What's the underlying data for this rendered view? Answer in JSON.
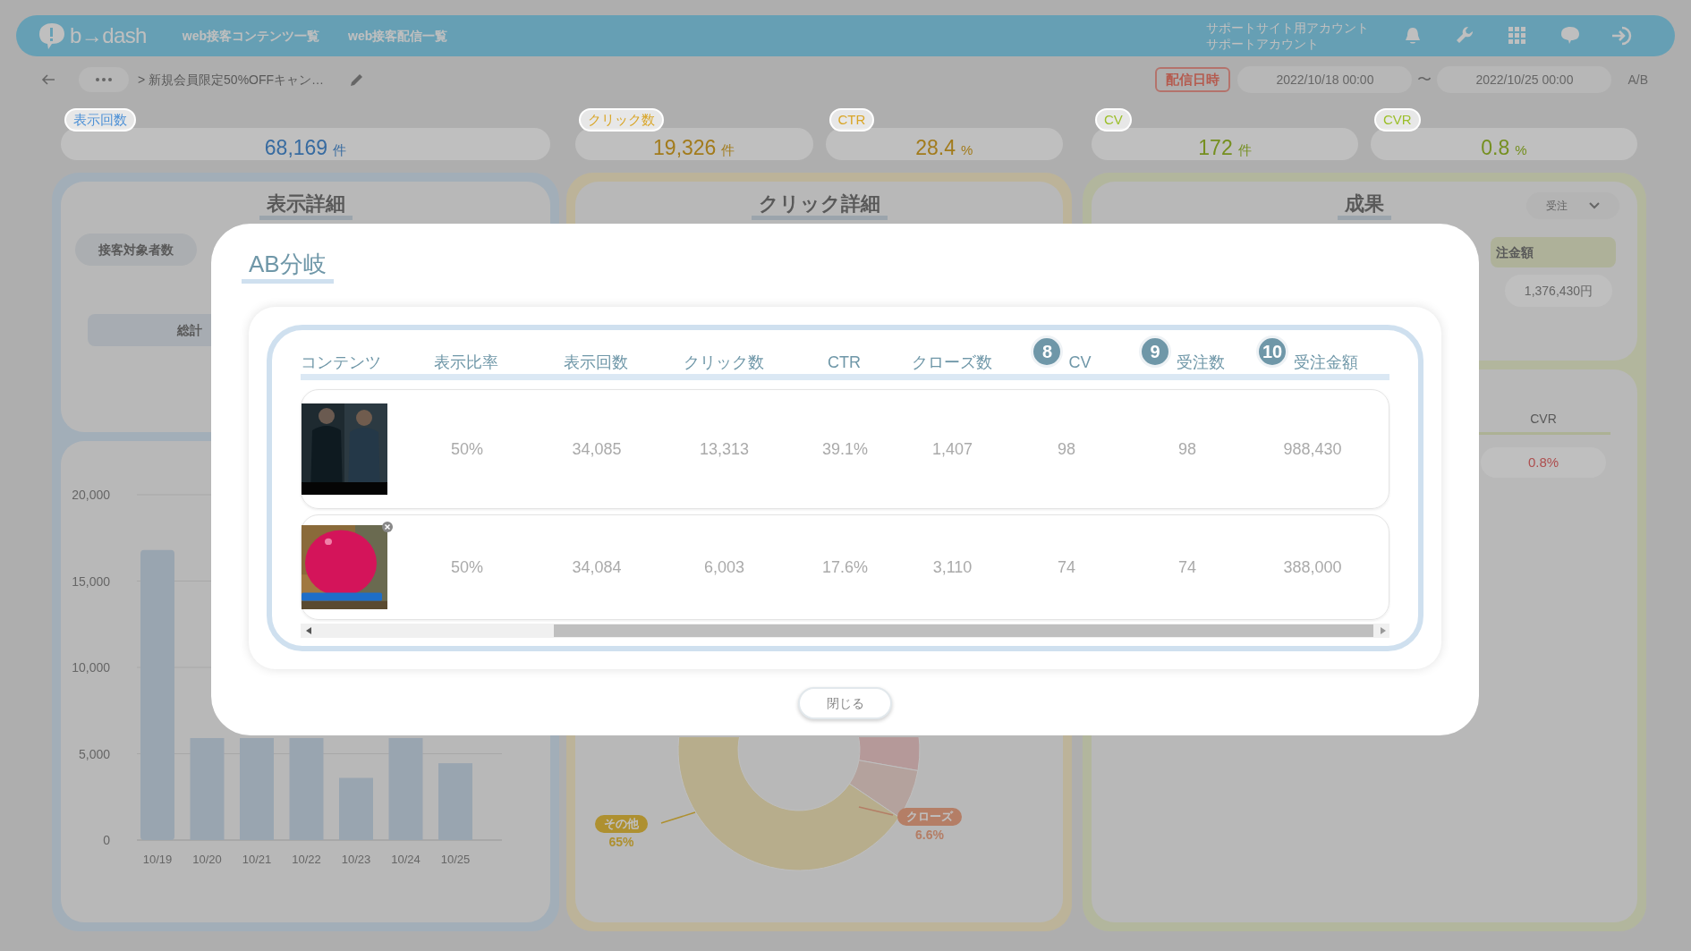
{
  "header": {
    "logo": "b→dash",
    "nav": [
      {
        "label": "web接客コンテンツ一覧"
      },
      {
        "label": "web接客配信一覧"
      }
    ],
    "account": [
      "サポートサイト用アカウント",
      "サポートアカウント"
    ]
  },
  "toolbar": {
    "breadcrumb": "> 新規会員限定50%OFFキャン…",
    "period_label": "配信日時",
    "start": "2022/10/18 00:00",
    "separator": "〜",
    "end": "2022/10/25 00:00",
    "mode": "A/B"
  },
  "groups": [
    {
      "kind": "views",
      "color": "#4a8fd6",
      "metrics": [
        {
          "label": "表示回数",
          "value": "68,169",
          "unit": "件"
        }
      ],
      "panel": {
        "title": "表示詳細",
        "tab": "接客対象者数",
        "row_label": "総計",
        "bar_chart": {
          "y_labels": [
            "20,000",
            "15,000",
            "10,000",
            "5,000",
            "0"
          ],
          "x_labels": [
            "10/19",
            "10/20",
            "10/21",
            "10/22",
            "10/23",
            "10/24",
            "10/25"
          ]
        }
      }
    },
    {
      "kind": "clicks",
      "color": "#d9a526",
      "metrics": [
        {
          "label": "クリック数",
          "value": "19,326",
          "unit": "件"
        },
        {
          "label": "CTR",
          "value": "28.4",
          "unit": "%"
        }
      ],
      "panel": {
        "title": "クリック詳細",
        "callouts": [
          {
            "label": "その他",
            "value": "65%"
          },
          {
            "label": "クローズ",
            "value": "6.6%"
          }
        ]
      }
    },
    {
      "kind": "results",
      "color": "#9cbf2a",
      "metrics": [
        {
          "label": "CV",
          "value": "172",
          "unit": "件"
        },
        {
          "label": "CVR",
          "value": "0.8",
          "unit": "%"
        }
      ],
      "panel": {
        "title": "成果",
        "dropdown": "受注",
        "column": "注金額",
        "amount": "1,376,430円",
        "sub_column": "CVR",
        "sub_value": "0.8%"
      }
    }
  ],
  "modal": {
    "title": "AB分岐",
    "columns": [
      {
        "label": "コンテンツ"
      },
      {
        "label": "表示比率"
      },
      {
        "label": "表示回数"
      },
      {
        "label": "クリック数"
      },
      {
        "label": "CTR"
      },
      {
        "label": "クローズ数"
      },
      {
        "label": "CV",
        "badge": "8"
      },
      {
        "label": "受注数",
        "badge": "9"
      },
      {
        "label": "受注金額",
        "badge": "10"
      }
    ],
    "rows": [
      {
        "cells": [
          {
            "kind": "picture",
            "dismiss_icon": false
          },
          "50%",
          "34,085",
          "13,313",
          "39.1%",
          "1,407",
          "98",
          "98",
          "988,430"
        ]
      },
      {
        "cells": [
          {
            "kind": "picture",
            "dismiss_icon": true
          },
          "50%",
          "34,084",
          "6,003",
          "17.6%",
          "3,110",
          "74",
          "74",
          "388,000"
        ]
      }
    ],
    "close_button": "閉じる"
  }
}
